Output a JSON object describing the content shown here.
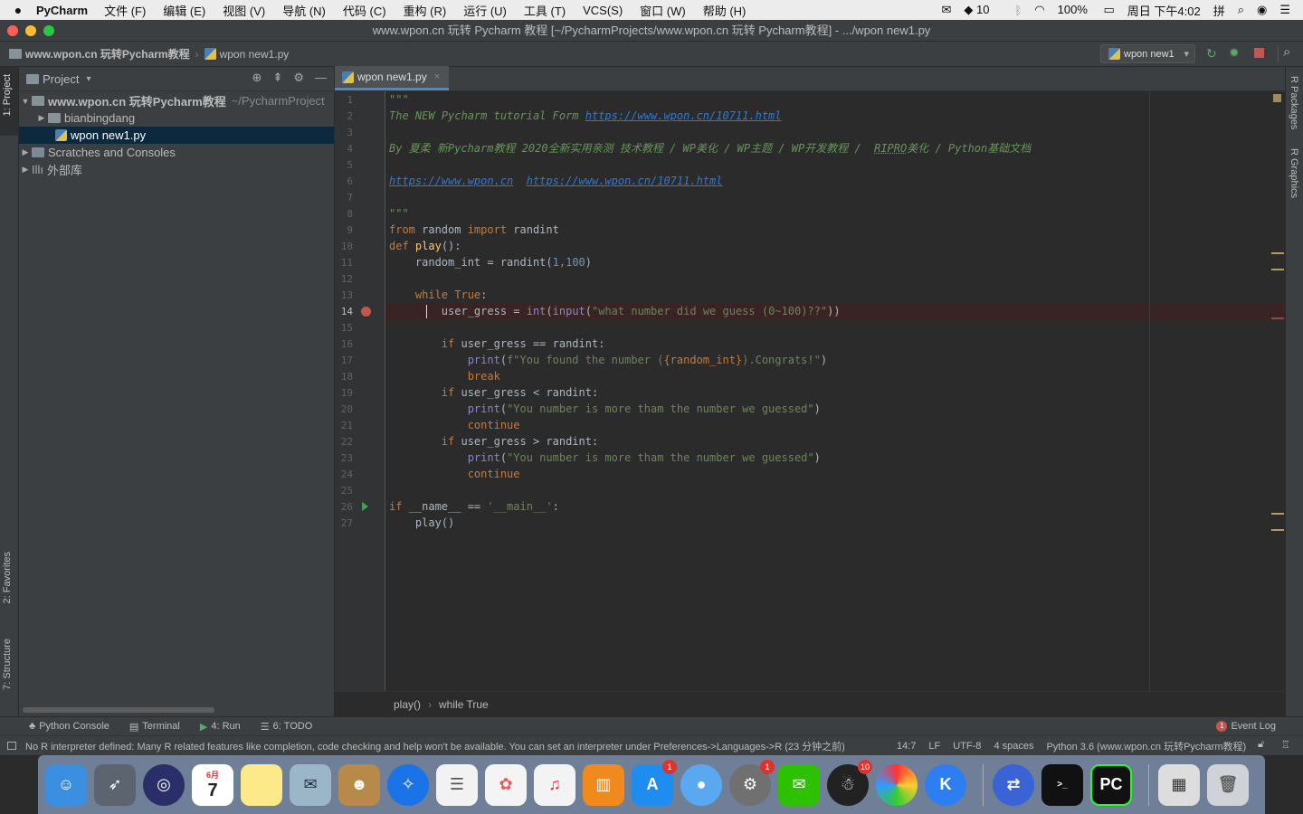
{
  "menubar": {
    "app": "PyCharm",
    "menus": [
      "文件 (F)",
      "编辑 (E)",
      "视图 (V)",
      "导航 (N)",
      "代码 (C)",
      "重构 (R)",
      "运行 (U)",
      "工具 (T)",
      "VCS(S)",
      "窗口 (W)",
      "帮助 (H)"
    ],
    "notif_count": "10",
    "battery": "100%",
    "clock": "周日 下午4:02"
  },
  "window": {
    "title": "www.wpon.cn 玩转 Pycharm 教程 [~/PycharmProjects/www.wpon.cn 玩转 Pycharm教程] - .../wpon new1.py"
  },
  "navbar": {
    "project_name": "www.wpon.cn 玩转Pycharm教程",
    "file_name": "wpon new1.py",
    "run_config": "wpon new1"
  },
  "sidebar_tabs": {
    "project": "1: Project",
    "favorites": "2: Favorites",
    "structure": "7: Structure"
  },
  "right_tabs": {
    "packages": "R Packages",
    "graphics": "R Graphics"
  },
  "project_panel": {
    "title": "Project",
    "root_name": "www.wpon.cn 玩转Pycharm教程",
    "root_path": "~/PycharmProject",
    "items": [
      {
        "label": "bianbingdang"
      },
      {
        "label": "wpon new1.py"
      },
      {
        "label": "Scratches and Consoles"
      },
      {
        "label": "外部库"
      }
    ]
  },
  "editor": {
    "tab": "wpon new1.py",
    "current_line": 14,
    "line_numbers": [
      "1",
      "2",
      "3",
      "4",
      "5",
      "6",
      "7",
      "8",
      "9",
      "10",
      "11",
      "12",
      "13",
      "14",
      "15",
      "16",
      "17",
      "18",
      "19",
      "20",
      "21",
      "22",
      "23",
      "24",
      "25",
      "26",
      "27"
    ],
    "code": {
      "l1": "\"\"\"",
      "l2a": "The NEW Pycharm tutorial Form ",
      "l2b": "https://www.wpon.cn/10711.html",
      "l4a": "By 夏柔 新Pycharm教程 2020全新实用亲测 技术教程 / WP美化 / WP主题 / WP开发教程 /  ",
      "l4b": "RIPRO",
      "l4c": "美化 / Python基础文档",
      "l6a": "https://www.wpon.cn",
      "l6b": "https://www.wpon.cn/10711.html",
      "l8": "\"\"\"",
      "l9a": "from",
      "l9b": " random ",
      "l9c": "import",
      "l9d": " randint",
      "l10a": "def",
      "l10b": "play",
      "l10c": "():",
      "l11a": "    random_int = randint(",
      "l11b": "1",
      "l11c": ",",
      "l11d": "100",
      "l11e": ")",
      "l13a": "    while",
      "l13b": " True",
      "l13c": ":",
      "l14a": "        user_gress = ",
      "l14b": "int",
      "l14c": "(",
      "l14d": "input",
      "l14e": "(",
      "l14f": "\"what number did we guess (0~100)??\"",
      "l14g": "))",
      "l16a": "        if",
      "l16b": " user_gress == randint:",
      "l17a": "            print",
      "l17b": "(",
      "l17c": "f\"You found the number (",
      "l17d": "{random_int}",
      "l17e": ").Congrats!\"",
      "l17f": ")",
      "l18": "            break",
      "l19a": "        if",
      "l19b": " user_gress < randint:",
      "l20a": "            print",
      "l20b": "(",
      "l20c": "\"You number is more tham the number we guessed\"",
      "l20d": ")",
      "l21": "            continue",
      "l22a": "        if",
      "l22b": " user_gress > randint:",
      "l23a": "            print",
      "l23b": "(",
      "l23c": "\"You number is more tham the number we guessed\"",
      "l23d": ")",
      "l24": "            continue",
      "l26a": "if",
      "l26b": " __name__ == ",
      "l26c": "'__main__'",
      "l26d": ":",
      "l27": "    play()"
    },
    "breadcrumb_func": "play()",
    "breadcrumb_stmt": "while True"
  },
  "toolwindows": {
    "python_console": "Python Console",
    "terminal": "Terminal",
    "run": "4: Run",
    "todo": "6: TODO",
    "event_log": "Event Log",
    "event_count": "1"
  },
  "statusbar": {
    "message": "No R interpreter defined: Many R related features like completion, code checking and help won't be available. You can set an interpreter under Preferences->Languages->R (23 分钟之前)",
    "position": "14:7",
    "line_sep": "LF",
    "encoding": "UTF-8",
    "indent": "4 spaces",
    "interpreter": "Python 3.6 (www.wpon.cn 玩转Pycharm教程)"
  },
  "dock": {
    "calendar_month": "6月",
    "calendar_day": "7",
    "badges": {
      "appstore": "1",
      "prefs": "1",
      "qq": "10"
    }
  },
  "colors": {
    "accent": "#4a88c7",
    "breakpoint": "#c75450",
    "keyword": "#cc7832",
    "string": "#6a8759"
  }
}
